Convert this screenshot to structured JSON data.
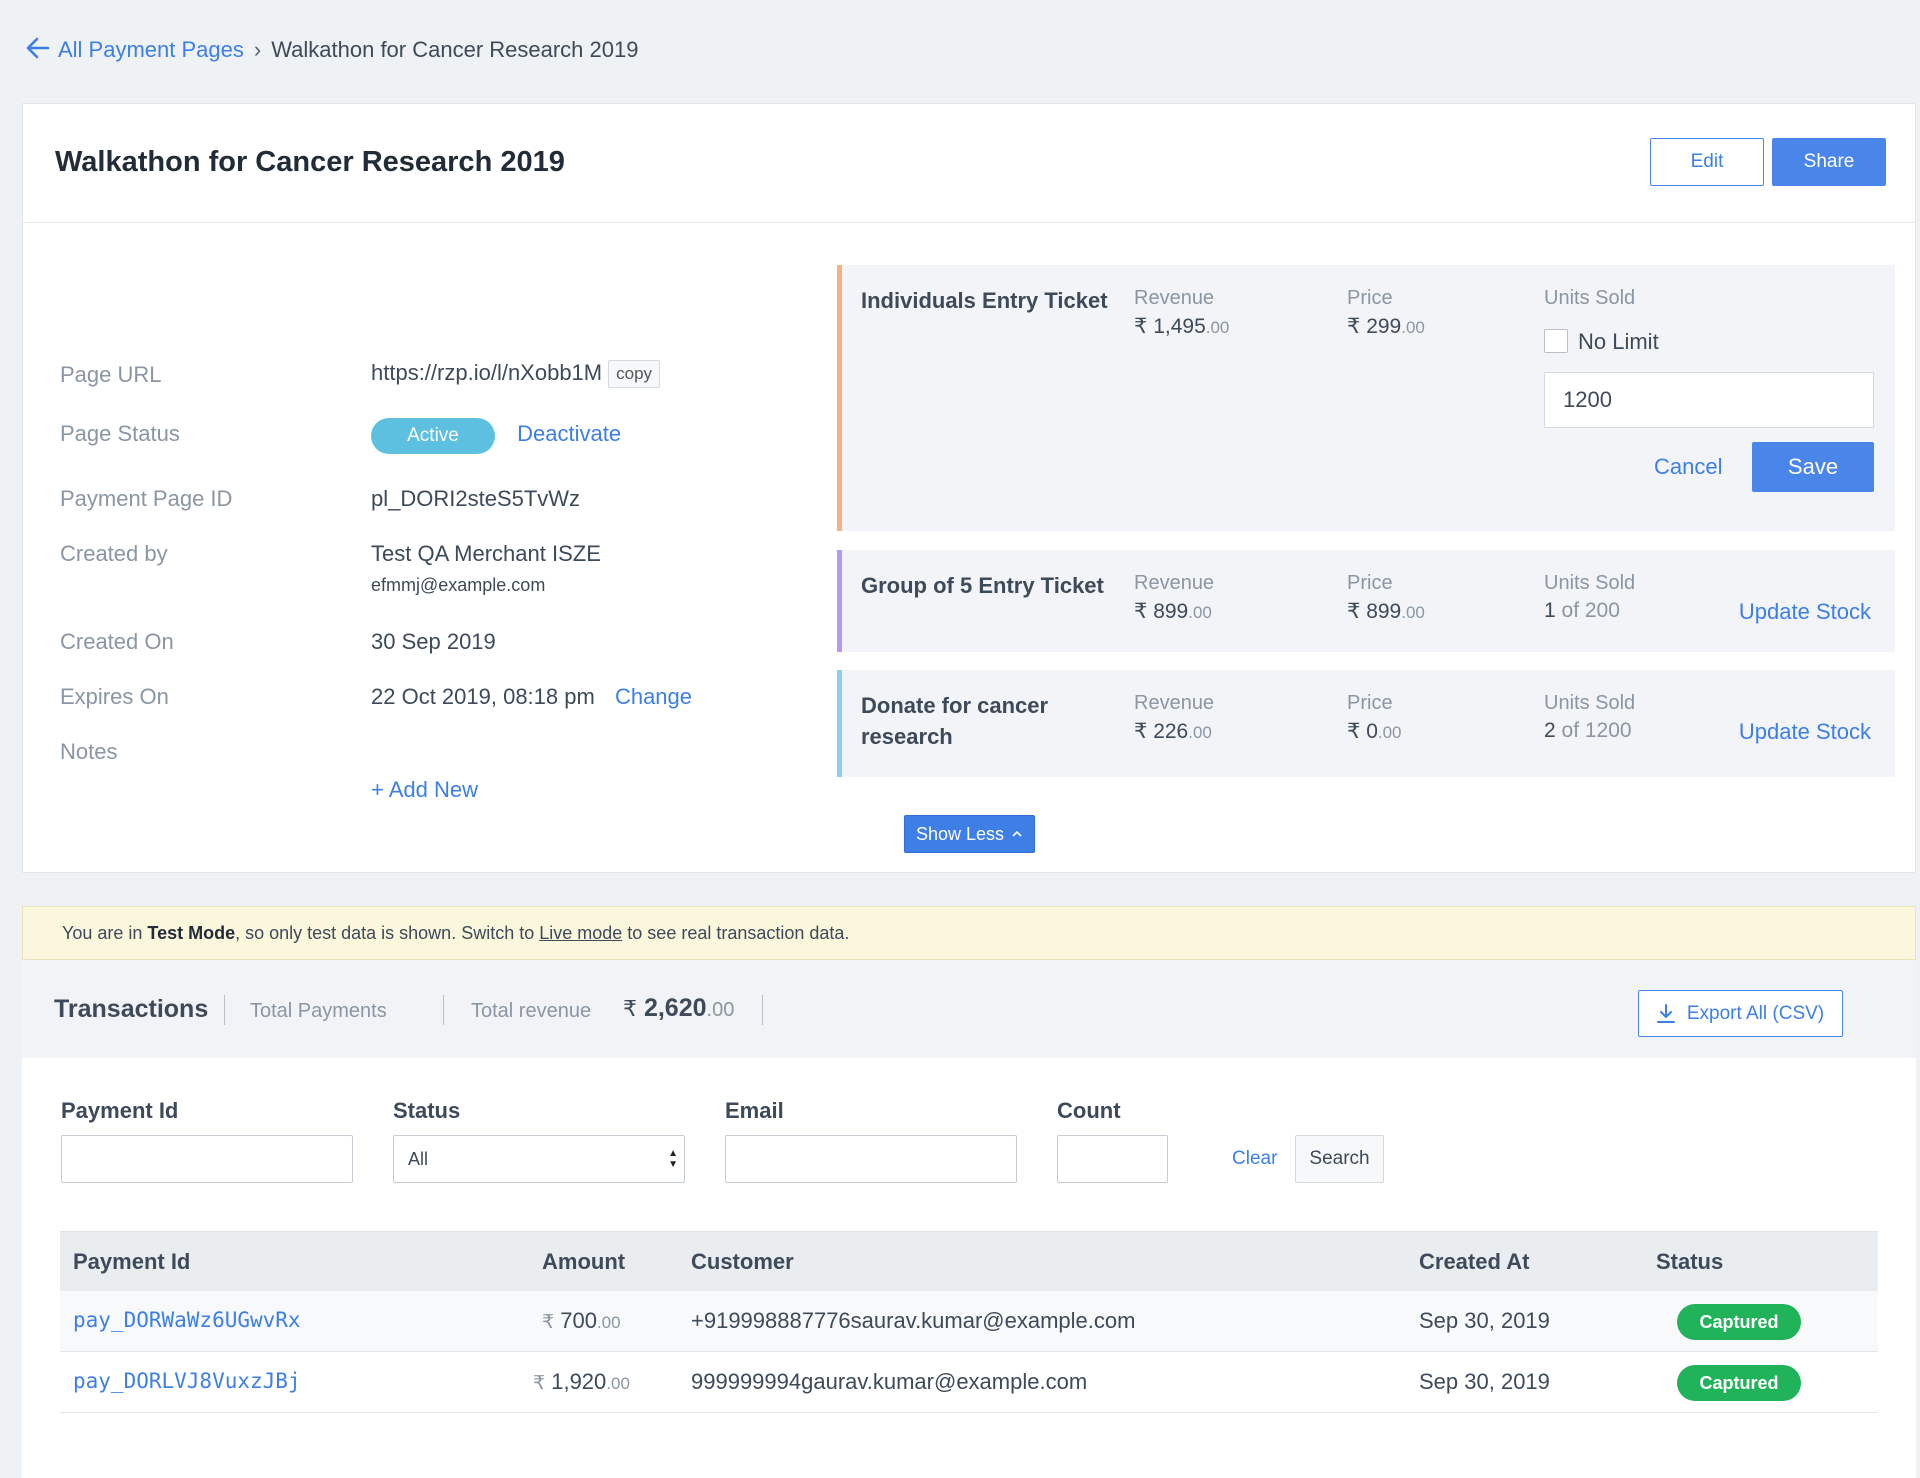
{
  "breadcrumb": {
    "parent": "All Payment Pages",
    "current": "Walkathon for Cancer Research 2019"
  },
  "page": {
    "title": "Walkathon for Cancer Research 2019",
    "edit_label": "Edit",
    "share_label": "Share"
  },
  "details": {
    "url_label": "Page URL",
    "url": "https://rzp.io/l/nXobb1M",
    "copy_label": "copy",
    "status_label": "Page Status",
    "status": "Active",
    "deactivate_label": "Deactivate",
    "id_label": "Payment Page ID",
    "id": "pl_DORI2steS5TvWz",
    "created_by_label": "Created by",
    "created_by": "Test QA Merchant ISZE",
    "created_by_email": "efmmj@example.com",
    "created_on_label": "Created On",
    "created_on": "30 Sep 2019",
    "expires_label": "Expires On",
    "expires": "22 Oct 2019, 08:18 pm",
    "change_label": "Change",
    "notes_label": "Notes",
    "add_new_label": "+ Add New"
  },
  "items": [
    {
      "name": "Individuals Entry Ticket",
      "revenue_label": "Revenue",
      "revenue_int": "₹ 1,495",
      "revenue_dec": ".00",
      "price_label": "Price",
      "price_int": "₹ 299",
      "price_dec": ".00",
      "units_label": "Units Sold",
      "no_limit_label": "No Limit",
      "units_value": "1200",
      "cancel_label": "Cancel",
      "save_label": "Save"
    },
    {
      "name": "Group of 5 Entry Ticket",
      "revenue_label": "Revenue",
      "revenue_int": "₹ 899",
      "revenue_dec": ".00",
      "price_label": "Price",
      "price_int": "₹ 899",
      "price_dec": ".00",
      "units_label": "Units Sold",
      "units_sold": "1",
      "units_total": " of 200",
      "update_label": "Update Stock"
    },
    {
      "name": "Donate for cancer research",
      "revenue_label": "Revenue",
      "revenue_int": "₹ 226",
      "revenue_dec": ".00",
      "price_label": "Price",
      "price_int": "₹ 0",
      "price_dec": ".00",
      "units_label": "Units Sold",
      "units_sold": "2",
      "units_total": " of 1200",
      "update_label": "Update Stock"
    }
  ],
  "show_less_label": "Show Less",
  "notice": {
    "prefix": "You are in ",
    "mode": "Test Mode",
    "middle": ", so only test data is shown. Switch to ",
    "link": "Live mode",
    "suffix": " to see real transaction data."
  },
  "transactions": {
    "title": "Transactions",
    "total_payments_label": "Total Payments",
    "total_revenue_label": "Total revenue",
    "revenue_symbol": "₹",
    "revenue_int": "2,620",
    "revenue_dec": ".00",
    "export_label": "Export All (CSV)"
  },
  "filters": {
    "payment_id_label": "Payment Id",
    "status_label": "Status",
    "status_value": "All",
    "email_label": "Email",
    "count_label": "Count",
    "clear_label": "Clear",
    "search_label": "Search"
  },
  "table": {
    "headers": [
      "Payment Id",
      "Amount",
      "Customer",
      "Created At",
      "Status"
    ],
    "rows": [
      {
        "id": "pay_DORWaWz6UGwvRx",
        "amount_int": "700",
        "amount_dec": ".00",
        "customer": "+919998887776saurav.kumar@example.com",
        "created": "Sep 30, 2019",
        "status": "Captured"
      },
      {
        "id": "pay_DORLVJ8VuxzJBj",
        "amount_int": "1,920",
        "amount_dec": ".00",
        "customer": "999999994gaurav.kumar@example.com",
        "created": "Sep 30, 2019",
        "status": "Captured"
      }
    ]
  },
  "colors": {
    "accent": "#4a86ea",
    "active_badge": "#5ec0e0",
    "captured": "#21b35a",
    "item_borders": [
      "#f6b183",
      "#b79af0",
      "#8ecfee"
    ]
  }
}
